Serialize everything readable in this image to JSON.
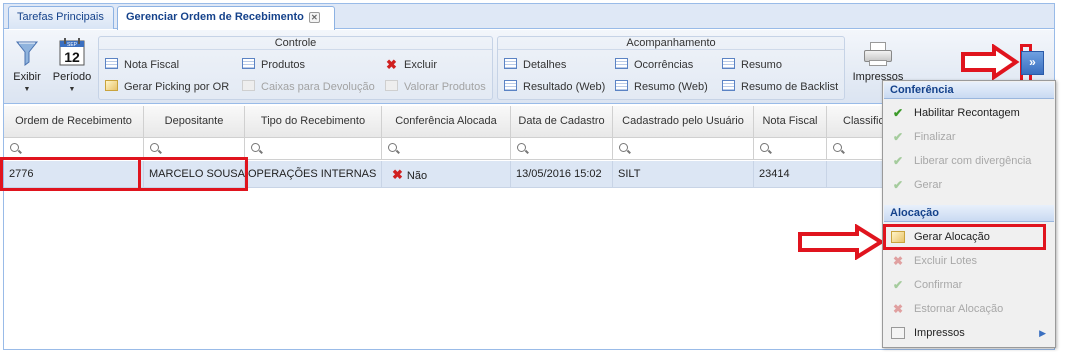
{
  "tabs": [
    {
      "label": "Tarefas Principais"
    },
    {
      "label": "Gerenciar Ordem de Recebimento"
    }
  ],
  "toolbar": {
    "exibir": "Exibir",
    "periodo": "Período",
    "calendar_day": "12",
    "calendar_month": "SEP",
    "impressos": "Impressos",
    "controle": {
      "title": "Controle",
      "items": [
        "Nota Fiscal",
        "Produtos",
        "Excluir",
        "Gerar Picking por OR",
        "Caixas para Devolução",
        "Valorar Produtos"
      ]
    },
    "acompanhamento": {
      "title": "Acompanhamento",
      "items": [
        "Detalhes",
        "Ocorrências",
        "Resumo",
        "Resultado (Web)",
        "Resumo (Web)",
        "Resumo de Backlist"
      ]
    },
    "expand_label": "»"
  },
  "grid": {
    "columns": [
      "Ordem de Recebimento",
      "Depositante",
      "Tipo do Recebimento",
      "Conferência Alocada",
      "Data de Cadastro",
      "Cadastrado pelo Usuário",
      "Nota Fiscal",
      "Classificação"
    ],
    "row": {
      "ordem": "2776",
      "depositante": "MARCELO SOUSA",
      "tipo": "OPERAÇÕES INTERNAS",
      "conferencia": "Não",
      "data": "13/05/2016 15:02",
      "usuario": "SILT",
      "nota": "23414",
      "classificacao": ""
    }
  },
  "menu": {
    "section1": "Conferência",
    "conf_items": [
      "Habilitar Recontagem",
      "Finalizar",
      "Liberar com divergência",
      "Gerar"
    ],
    "section2": "Alocação",
    "aloc_items": [
      "Gerar Alocação",
      "Excluir Lotes",
      "Confirmar",
      "Estornar Alocação"
    ],
    "impressos": "Impressos"
  },
  "colors": {
    "highlight": "#e0141e",
    "row_selected": "#dce6f4",
    "accent": "#15428b"
  }
}
